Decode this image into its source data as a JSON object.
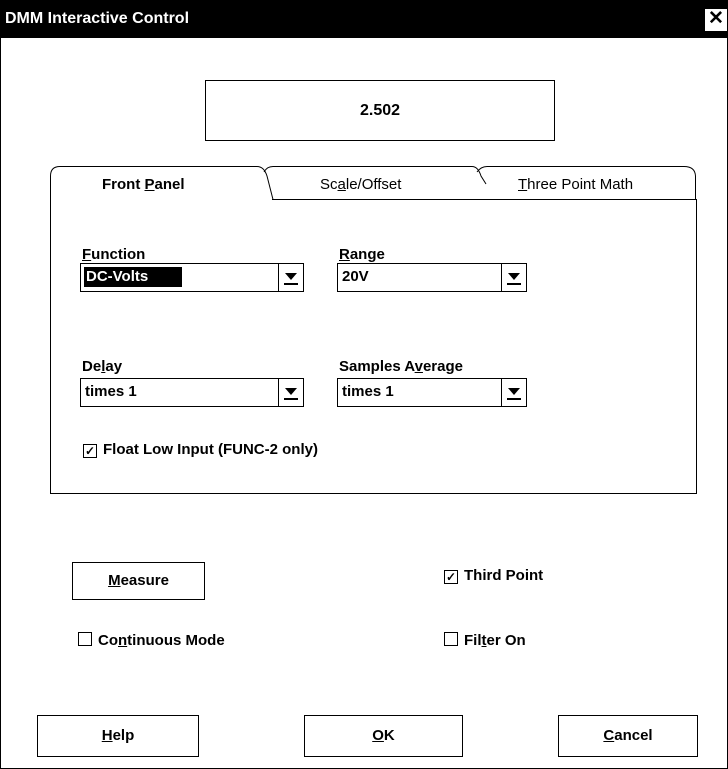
{
  "window": {
    "title": "DMM Interactive Control",
    "close_glyph": "✕"
  },
  "display": {
    "value": "2.502"
  },
  "tabs": [
    {
      "label_pre": "Front ",
      "label_key": "P",
      "label_post": "anel",
      "active": true
    },
    {
      "label_pre": "Sc",
      "label_key": "a",
      "label_post": "le/Offset",
      "active": false
    },
    {
      "label_pre": "",
      "label_key": "T",
      "label_post": "hree Point Math",
      "active": false
    }
  ],
  "front_panel": {
    "function": {
      "label_key": "F",
      "label_post": "unction",
      "value": "DC-Volts"
    },
    "range": {
      "label_key": "R",
      "label_post": "ange",
      "value": "20V"
    },
    "delay": {
      "label_pre": "De",
      "label_key": "l",
      "label_post": "ay",
      "value": "times 1"
    },
    "samples_average": {
      "label_pre": "Samples A",
      "label_key": "v",
      "label_post": "erage",
      "value": "times 1"
    },
    "float_low_input": {
      "label": "Float Low Input (FUNC-2 only)",
      "checked": true
    }
  },
  "controls": {
    "measure": {
      "label_key": "M",
      "label_post": "easure"
    },
    "third_point": {
      "label": "Third Point",
      "checked": true
    },
    "continuous_mode": {
      "label_pre": "Co",
      "label_key": "n",
      "label_post": "tinuous Mode",
      "checked": false
    },
    "filter_on": {
      "label_pre": "Fil",
      "label_key": "t",
      "label_post": "er On",
      "checked": false
    }
  },
  "buttons": {
    "help": {
      "label_key": "H",
      "label_post": "elp"
    },
    "ok": {
      "label_key": "O",
      "label_post": "K"
    },
    "cancel": {
      "label_key": "C",
      "label_post": "ancel"
    }
  },
  "icons": {
    "checkbox_checked": "✓",
    "dropdown": "dropdown-arrow-icon"
  }
}
